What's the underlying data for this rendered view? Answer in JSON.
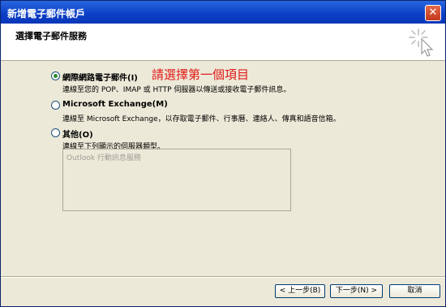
{
  "window": {
    "title": "新增電子郵件帳戶",
    "close_glyph": "✕"
  },
  "header": {
    "title": "選擇電子郵件服務"
  },
  "options": [
    {
      "label": "網際網路電子郵件(I)",
      "description": "連線至您的 POP、IMAP 或 HTTP 伺服器以傳送或接收電子郵件訊息。",
      "selected": true
    },
    {
      "label": "Microsoft Exchange(M)",
      "description": "連線至 Microsoft Exchange，以存取電子郵件、行事曆、連絡人、傳真和語音信箱。",
      "selected": false
    },
    {
      "label": "其他(O)",
      "description": "連線至下列顯示的伺服器類型。",
      "selected": false
    }
  ],
  "annotation": "請選擇第一個項目",
  "server_list": {
    "items": [
      "Outlook 行動訊息服務"
    ]
  },
  "buttons": {
    "back": "< 上一步(B)",
    "next": "下一步(N) >",
    "cancel": "取消"
  },
  "colors": {
    "titlebar": "#0b3ec6",
    "annotation": "#e21a1a",
    "dialog_bg": "#ece9d8"
  },
  "icons": {
    "wizard": "sparkle-cursor-icon",
    "close": "close-icon"
  }
}
